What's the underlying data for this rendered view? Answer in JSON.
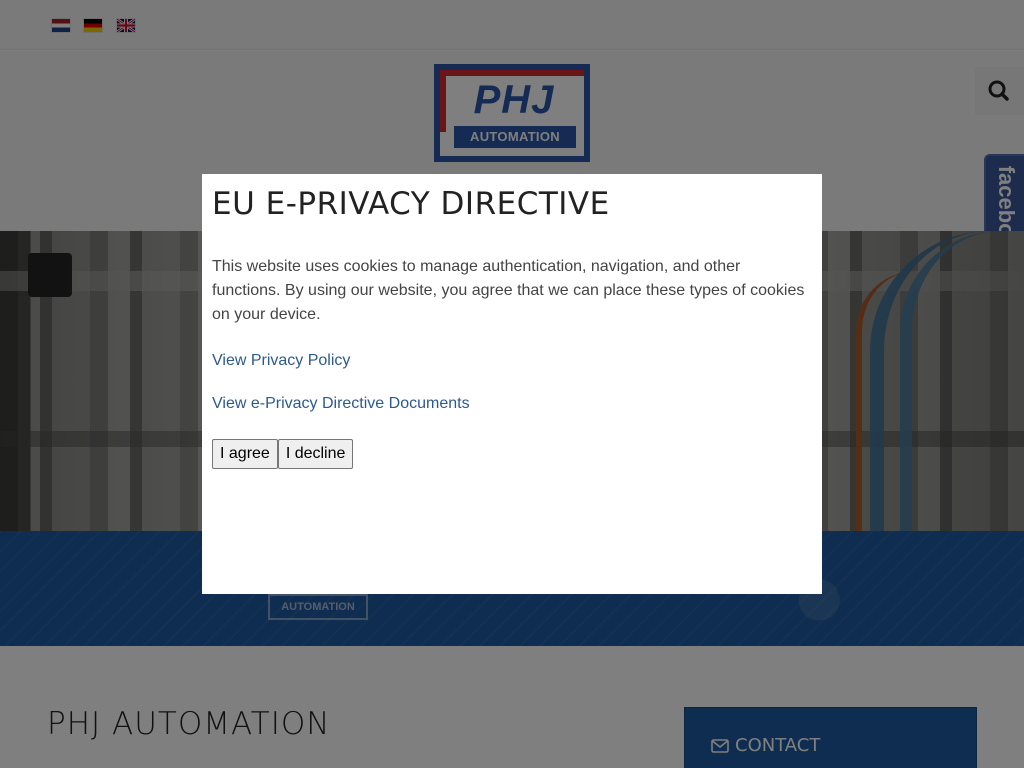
{
  "language_bar": {
    "languages": [
      {
        "code": "nl",
        "icon": "flag-netherlands-icon"
      },
      {
        "code": "de",
        "icon": "flag-germany-icon"
      },
      {
        "code": "en",
        "icon": "flag-uk-icon"
      }
    ]
  },
  "header": {
    "logo": {
      "word": "PHJ",
      "tagline": "AUTOMATION",
      "colors": {
        "blue": "#2a57a6",
        "red": "#d52b2f"
      }
    },
    "search_icon": "search-icon",
    "facebook_label": "facebook"
  },
  "banner": {
    "logo_text": "AUTOMATION",
    "color": "#1f5aa0"
  },
  "content": {
    "title": "PHJ AUTOMATION",
    "contact": {
      "icon": "envelope-icon",
      "label": "CONTACT"
    }
  },
  "modal": {
    "title": "EU E-PRIVACY DIRECTIVE",
    "body": "This website uses cookies to manage authentication, navigation, and other functions. By using our website, you agree that we can place these types of cookies on your device.",
    "privacy_link": "View Privacy Policy",
    "directive_link": "View e-Privacy Directive Documents",
    "agree_label": "I agree",
    "decline_label": "I decline"
  }
}
